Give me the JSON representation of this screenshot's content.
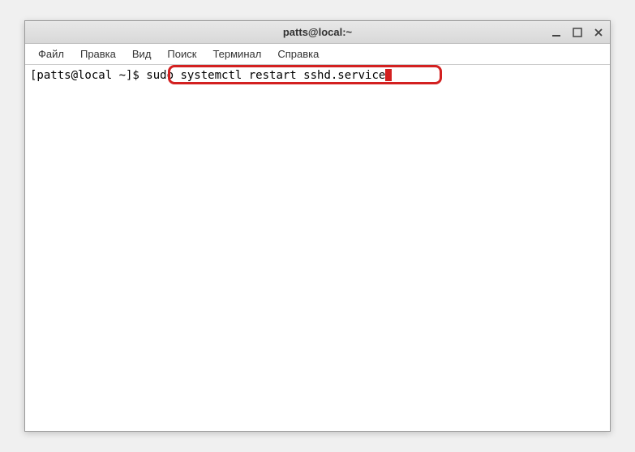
{
  "window": {
    "title": "patts@local:~"
  },
  "menu": {
    "file": "Файл",
    "edit": "Правка",
    "view": "Вид",
    "search": "Поиск",
    "terminal": "Терминал",
    "help": "Справка"
  },
  "terminal": {
    "prompt": "[patts@local ~]$ ",
    "command": "sudo systemctl restart sshd.service"
  },
  "iconNames": {
    "minimize": "minimize-icon",
    "maximize": "maximize-icon",
    "close": "close-icon"
  }
}
